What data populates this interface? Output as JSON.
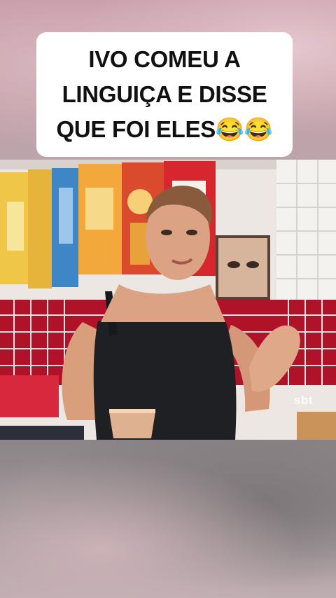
{
  "caption": {
    "line1": "IVO COMEU A",
    "line2": "LINGUIÇA E DISSE",
    "line3": "QUE FOI ELES",
    "emoji": "😂😂"
  },
  "video": {
    "watermark": "sbt",
    "scene": {
      "person": "woman",
      "icons": [
        "purse-strap",
        "cup"
      ]
    }
  },
  "colors": {
    "caption_bg": "#ffffff",
    "caption_text": "#111111",
    "tile_red": "#b0122a",
    "wall_white": "#f4f2ef"
  }
}
